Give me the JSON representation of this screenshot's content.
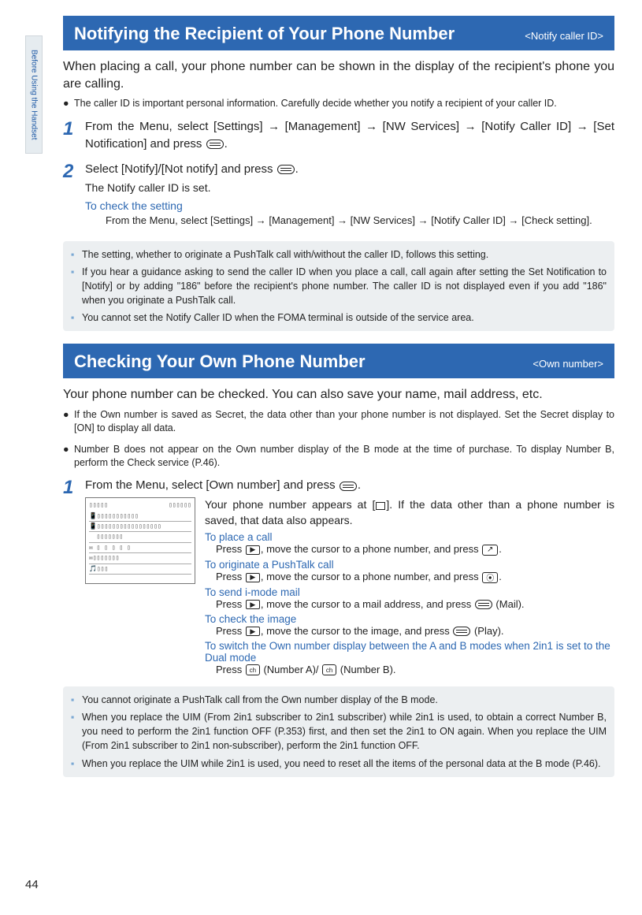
{
  "side_tab": "Before Using the Handset",
  "page_number": "44",
  "section1": {
    "title": "Notifying the Recipient of Your Phone Number",
    "tag": "<Notify caller ID>",
    "intro": "When placing a call, your phone number can be shown in the display of the recipient's phone you are calling.",
    "bullet": "The caller ID is important personal information. Carefully decide whether you notify a recipient of your caller ID.",
    "step1_num": "1",
    "step1_a": "From the Menu, select [Settings] → [Management] → [NW Services] → [Notify Caller ID] → [Set Notification] and press ",
    "step1_b": ".",
    "step2_num": "2",
    "step2_a": "Select [Notify]/[Not notify] and press ",
    "step2_b": ".",
    "step2_sub": "The Notify caller ID is set.",
    "step2_check_head": "To check the setting",
    "step2_check_body": "From the Menu, select [Settings] → [Management] → [NW Services] → [Notify Caller ID] → [Check setting].",
    "notes": [
      "The setting, whether to originate a PushTalk call with/without the caller ID, follows this setting.",
      "If you hear a guidance asking to send the caller ID when you place a call, call again after setting the Set Notification to [Notify] or by adding \"186\" before the recipient's phone number. The caller ID is not displayed even if you add \"186\" when you originate a PushTalk call.",
      "You cannot set the Notify Caller ID when the FOMA terminal is outside of the service area."
    ]
  },
  "section2": {
    "title": "Checking Your Own Phone Number",
    "tag": "<Own number>",
    "intro": "Your phone number can be checked. You can also save your name, mail address, etc.",
    "bullets": [
      "If the Own number is saved as Secret, the data other than your phone number is not displayed. Set the Secret display to [ON] to display all data.",
      "Number B does not appear on the Own number display of the B mode at the time of purchase. To display Number B, perform the Check service (P.46)."
    ],
    "step1_num": "1",
    "step1_a": "From the Menu, select [Own number] and press ",
    "step1_b": ".",
    "desc_a": "Your phone number appears at [",
    "desc_b": "]. If the data other than a phone number is saved, that data also appears.",
    "actions": {
      "call_head": "To place a call",
      "call_a": "Press ",
      "call_b": ", move the cursor to a phone number, and press ",
      "call_c": ".",
      "push_head": "To originate a PushTalk call",
      "push_a": "Press ",
      "push_b": ", move the cursor to a phone number, and press ",
      "push_c": ".",
      "mail_head": "To send i-mode mail",
      "mail_a": "Press ",
      "mail_b": ", move the cursor to a mail address, and press ",
      "mail_c": " (Mail).",
      "img_head": "To check the image",
      "img_a": "Press ",
      "img_b": ", move the cursor to the image, and press ",
      "img_c": " (Play).",
      "dual_head": "To switch the Own number display between the A and B modes when 2in1 is set to the Dual mode",
      "dual_a": "Press ",
      "dual_b": " (Number A)/ ",
      "dual_c": " (Number B)."
    },
    "notes": [
      "You cannot originate a PushTalk call from the Own number display of the B mode.",
      "When you replace the UIM (From 2in1 subscriber to 2in1 subscriber) while 2in1 is used, to obtain a correct Number B, you need to perform the 2in1 function OFF (P.353) first, and then set the 2in1 to ON again. When you replace the UIM (From 2in1 subscriber to 2in1 non-subscriber), perform the 2in1 function OFF.",
      "When you replace the UIM while 2in1 is used, you need to reset all the items of the personal data at the B mode (P.46)."
    ]
  }
}
